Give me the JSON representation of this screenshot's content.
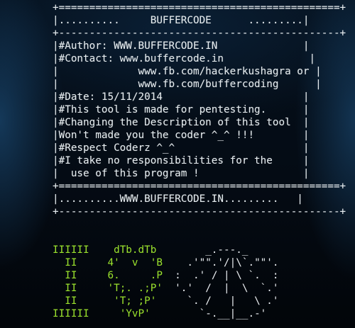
{
  "banner": {
    "lines": [
      "+==============================================+",
      "|..........     BUFFERCODE      .........|",
      "+----------------------------------------------+",
      "|#Author: WWW.BUFFERCODE.IN              |",
      "|#Contact: www.buffercode.in              |",
      "|             www.fb.com/hackerkushagra or |",
      "|             www.fb.com/buffercoding      |",
      "|#Date: 15/11/2014                       |",
      "|#This tool is made for pentesting.      |",
      "|#Changing the Description of this tool  |",
      "|Won't made you the coder ^_^ !!!        |",
      "|#Respect Coderz ^_^                     |",
      "|#I take no responsibilities for the     |",
      "|  use of this program !                 |",
      "+==============================================+",
      "|..........WWW.BUFFERCODE.IN.........   |",
      "+----------------------------------------------+"
    ]
  },
  "ascii_art": {
    "lines": [
      {
        "left": "IIIIII",
        "middle": "    dTb.dTb      ",
        "right": "  _.---._"
      },
      {
        "left": "  II  ",
        "middle": "   4'  v  'B    ",
        "right": ".'\"\".'/|\\`.\"\"'."
      },
      {
        "left": "  II  ",
        "middle": "   6.     .P  ",
        "right": ":  .' / | \\ `.  :"
      },
      {
        "left": "  II  ",
        "middle": "   'T;. .;P'  ",
        "right": "'.'  /  |  \\  `.'"
      },
      {
        "left": "  II  ",
        "middle": "    'T; ;P'   ",
        "right": "  `. /   |   \\ .'"
      },
      {
        "left": "IIIIII",
        "middle": "     'YvP'    ",
        "right": "    `-.__|__.-'"
      }
    ]
  },
  "colors": {
    "text": "#e6ecef",
    "ascii_green": "#9be22d",
    "background": "#02070f"
  }
}
